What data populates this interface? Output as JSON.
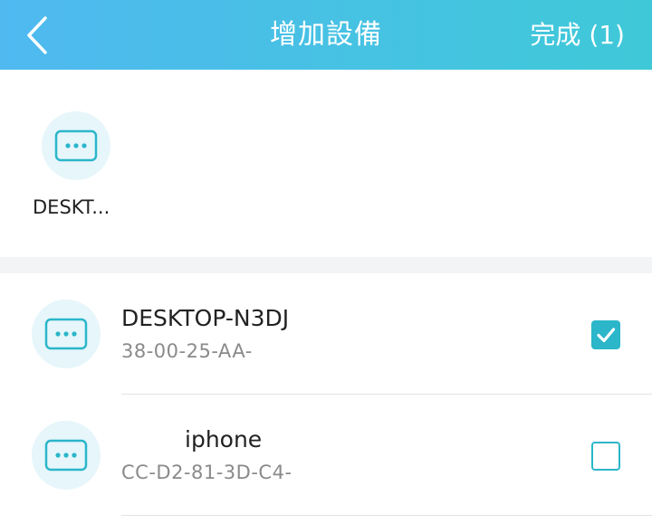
{
  "header": {
    "title": "增加設備",
    "done_label": "完成 (1)"
  },
  "selected": {
    "items": [
      {
        "label": "DESKT...",
        "icon": "device-dots-icon"
      }
    ]
  },
  "devices": [
    {
      "name": "DESKTOP-N3DJ",
      "mac": "38-00-25-AA-",
      "checked": true,
      "icon": "device-dots-icon"
    },
    {
      "name": "iphone",
      "mac": "CC-D2-81-3D-C4-",
      "checked": false,
      "icon": "device-dots-icon"
    }
  ],
  "colors": {
    "header_start": "#4fb9f0",
    "header_end": "#3fc9d8",
    "accent": "#2bb6c9",
    "avatar_bg": "#e6f6fb"
  }
}
